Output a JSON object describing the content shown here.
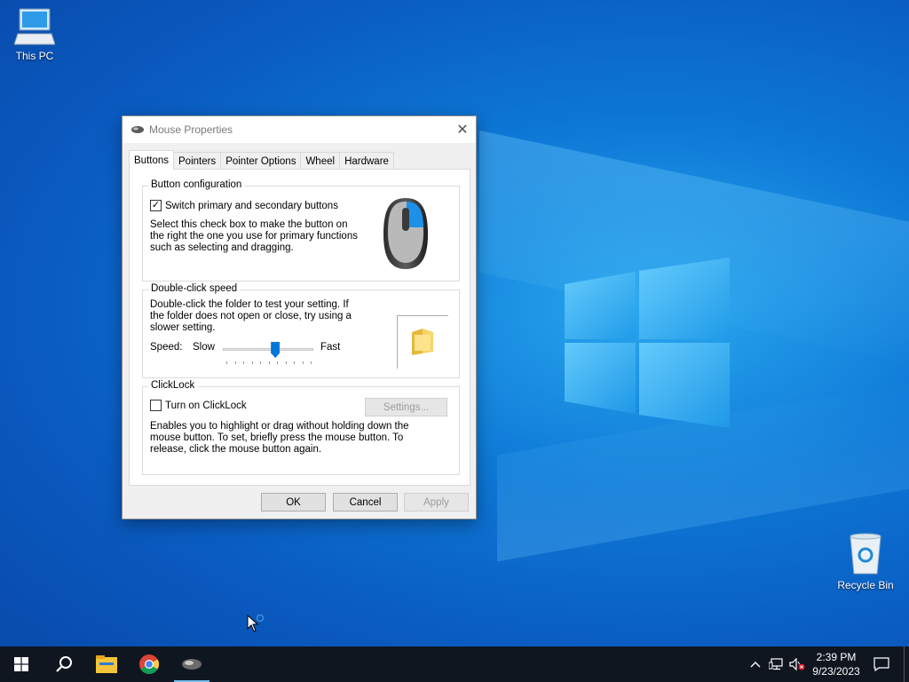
{
  "desktop": {
    "icons": [
      {
        "label": "This PC",
        "icon": "computer-icon"
      },
      {
        "label": "Recycle Bin",
        "icon": "recycle-bin-icon"
      }
    ]
  },
  "dialog": {
    "title": "Mouse Properties",
    "title_icon": "mouse-icon",
    "close_glyph": "✕",
    "tabs": [
      "Buttons",
      "Pointers",
      "Pointer Options",
      "Wheel",
      "Hardware"
    ],
    "active_tab": "Buttons",
    "button_config": {
      "legend": "Button configuration",
      "switch_label": "Switch primary and secondary buttons",
      "switch_checked": true,
      "description": "Select this check box to make the button on the right the one you use for primary functions such as selecting and dragging."
    },
    "double_click": {
      "legend": "Double-click speed",
      "description": "Double-click the folder to test your setting. If the folder does not open or close, try using a slower setting.",
      "speed_label": "Speed:",
      "slow_label": "Slow",
      "fast_label": "Fast",
      "speed_fraction": 0.58
    },
    "clicklock": {
      "legend": "ClickLock",
      "toggle_label": "Turn on ClickLock",
      "toggle_checked": false,
      "settings_label": "Settings...",
      "description": "Enables you to highlight or drag without holding down the mouse button. To set, briefly press the mouse button. To release, click the mouse button again."
    },
    "buttons": {
      "ok": "OK",
      "cancel": "Cancel",
      "apply": "Apply"
    }
  },
  "taskbar": {
    "items": [
      "start-icon",
      "search-icon",
      "file-explorer-icon",
      "chrome-icon",
      "mouse-properties-icon"
    ],
    "tray": {
      "time": "2:39 PM",
      "date": "9/23/2023",
      "icons": [
        "chevron-up-icon",
        "network-icon",
        "volume-muted-icon",
        "notification-icon"
      ]
    }
  },
  "colors": {
    "accent": "#0078d7",
    "taskbar": "#0f1620"
  }
}
